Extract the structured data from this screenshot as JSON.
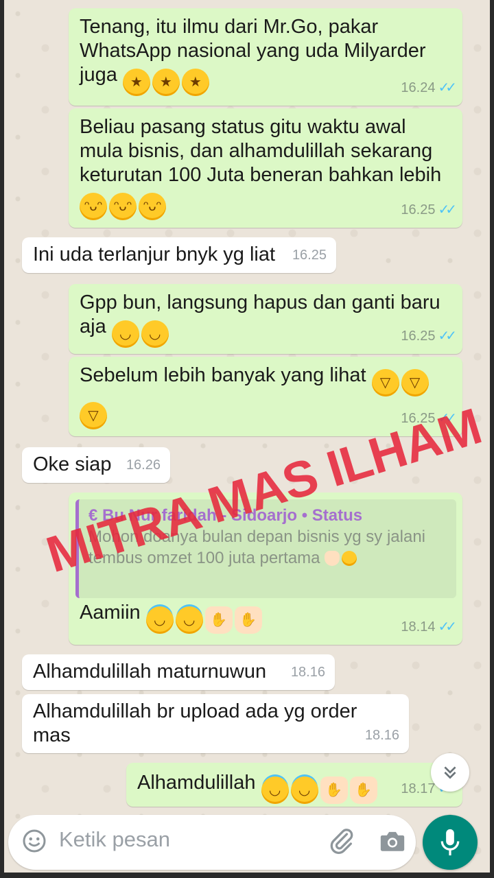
{
  "messages": [
    {
      "text": "Tenang, itu ilmu dari Mr.Go, pakar WhatsApp nasional yang uda Milyarder juga",
      "time": "16.24"
    },
    {
      "text": "Beliau pasang status gitu waktu awal mula bisnis, dan alhamdulillah sekarang keturutan 100 Juta beneran bahkan lebih",
      "time": "16.25"
    },
    {
      "text": "Ini uda terlanjur bnyk yg liat",
      "time": "16.25"
    },
    {
      "text": "Gpp bun, langsung hapus dan ganti baru aja",
      "time": "16.25"
    },
    {
      "text": "Sebelum lebih banyak yang lihat",
      "time": "16.25"
    },
    {
      "text": "Oke siap",
      "time": "16.26"
    },
    {
      "quote_author": "€ Bu Nur faridah - Sidoarjo • Status",
      "quote_text": "Mohon doanya bulan depan bisnis yg sy jalani tembus omzet 100 juta pertama",
      "text": "Aamiin",
      "time": "18.14"
    },
    {
      "text": "Alhamdulillah maturnuwun",
      "time": "18.16"
    },
    {
      "text": "Alhamdulillah br upload ada yg order mas",
      "time": "18.16"
    },
    {
      "text": "Alhamdulillah",
      "time": "18.17"
    }
  ],
  "watermark": "MITRA MAS ILHAM",
  "input": {
    "placeholder": "Ketik pesan"
  },
  "icons": {
    "emoji": "emoji-icon",
    "attach": "paperclip-icon",
    "camera": "camera-icon",
    "mic": "mic-icon",
    "scroll": "chevron-double-down-icon"
  },
  "colors": {
    "outgoing": "#dcf8c6",
    "incoming": "#ffffff",
    "read_tick": "#4fc3f7",
    "mic_button": "#00897b",
    "watermark": "#e6283c"
  }
}
